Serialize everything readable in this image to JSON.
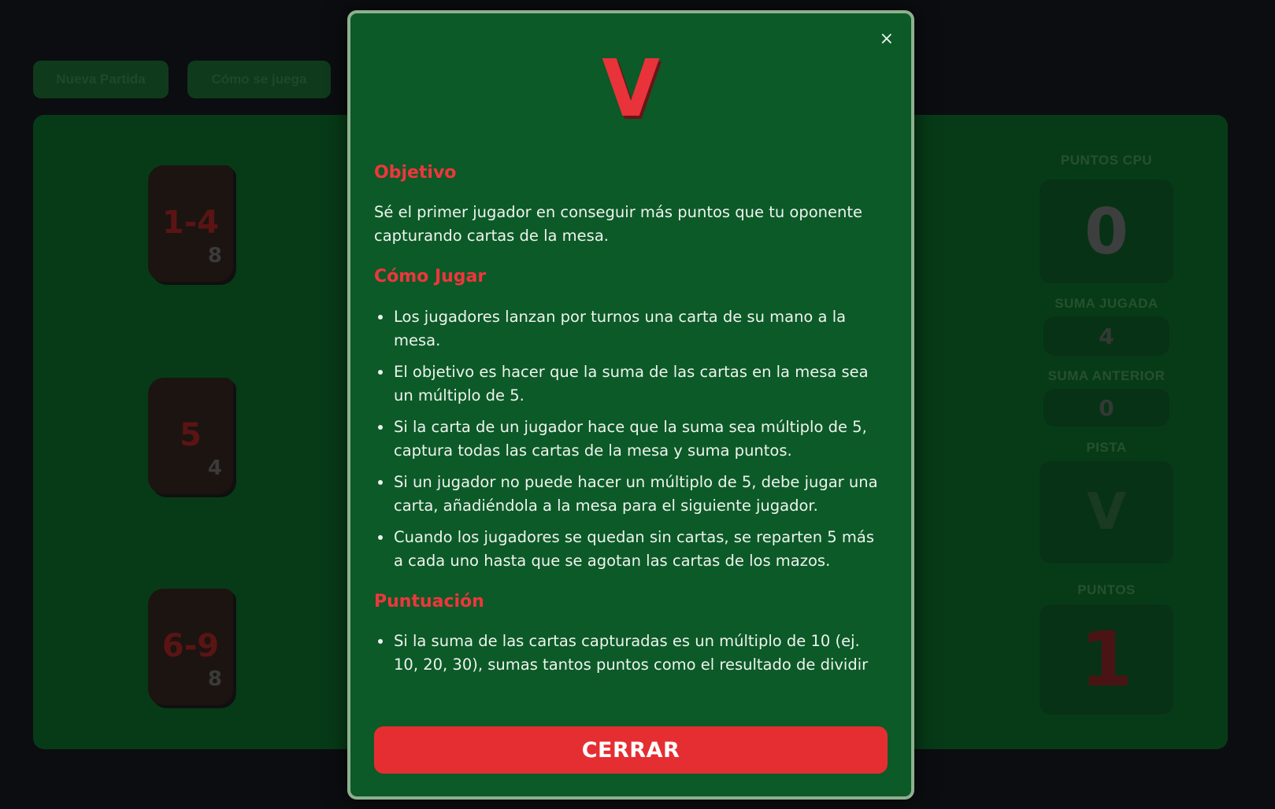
{
  "toolbar": {
    "new_game_label": "Nueva Partida",
    "how_to_play_label": "Cómo se juega"
  },
  "decks": [
    {
      "range": "1-4",
      "count": "8"
    },
    {
      "range": "5",
      "count": "4"
    },
    {
      "range": "6-9",
      "count": "8"
    }
  ],
  "stats": {
    "cpu_points_label": "PUNTOS CPU",
    "cpu_points_value": "0",
    "played_sum_label": "SUMA JUGADA",
    "played_sum_value": "4",
    "previous_sum_label": "SUMA ANTERIOR",
    "previous_sum_value": "0",
    "hint_label": "PISTA",
    "hint_value": "V",
    "points_label": "PUNTOS",
    "points_value": "1"
  },
  "modal": {
    "logo": "V",
    "close_glyph": "×",
    "objective_heading": "Objetivo",
    "objective_text": "Sé el primer jugador en conseguir más puntos que tu oponente capturando cartas de la mesa.",
    "how_heading": "Cómo Jugar",
    "how_items": [
      "Los jugadores lanzan por turnos una carta de su mano a la mesa.",
      "El objetivo es hacer que la suma de las cartas en la mesa sea un múltiplo de 5.",
      "Si la carta de un jugador hace que la suma sea múltiplo de 5, captura todas las cartas de la mesa y suma puntos.",
      "Si un jugador no puede hacer un múltiplo de 5, debe jugar una carta, añadiéndola a la mesa para el siguiente jugador.",
      "Cuando los jugadores se quedan sin cartas, se reparten 5 más a cada uno hasta que se agotan las cartas de los mazos."
    ],
    "scoring_heading": "Puntuación",
    "scoring_items": [
      "Si la suma de las cartas capturadas es un múltiplo de 10 (ej. 10, 20, 30), sumas tantos puntos como el resultado de dividir"
    ],
    "close_button_label": "CERRAR"
  }
}
